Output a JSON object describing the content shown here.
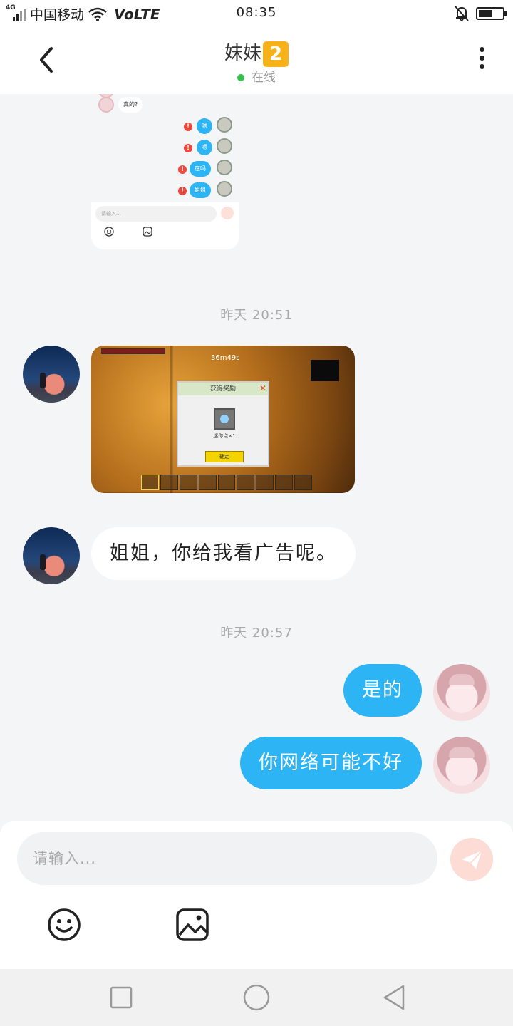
{
  "status_bar": {
    "network_type": "4G",
    "carrier": "中国移动",
    "volte": "VoLTE",
    "time": "08:35",
    "battery_level": 0.6,
    "icons": [
      "signal-icon",
      "wifi-icon",
      "bell-off-icon",
      "battery-icon"
    ]
  },
  "header": {
    "title": "妹妹",
    "badge": "2",
    "status": "在线",
    "status_color": "#33c24a"
  },
  "messages": {
    "image1_mini": {
      "in_text": "真的?",
      "out_texts": [
        "嗯",
        "嗯",
        "在吗",
        "姐姐"
      ],
      "error_mark": "!",
      "input_placeholder": "请输入..."
    },
    "timestamp_1": "昨天 20:51",
    "image2_game": {
      "timer": "36m49s",
      "dialog_title": "获得奖励",
      "dialog_close": "✕",
      "item_name": "迷你点×1",
      "ok_label": "确定"
    },
    "msg_in_1": "姐姐，你给我看广告呢。",
    "timestamp_2": "昨天 20:57",
    "msg_out_1": "是的",
    "msg_out_2": "你网络可能不好"
  },
  "input": {
    "placeholder": "请输入..."
  },
  "colors": {
    "outgoing_bubble": "#2cb4f4",
    "incoming_bubble": "#ffffff",
    "badge": "#f7b21a",
    "send_button": "#fcdcd5"
  }
}
